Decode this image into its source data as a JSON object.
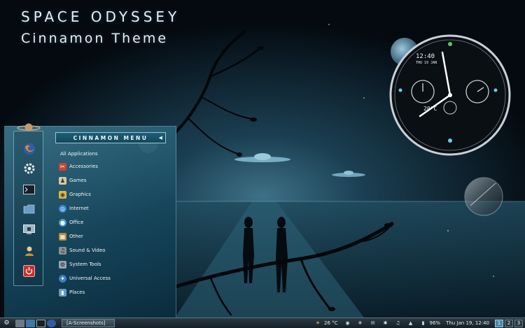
{
  "wallpaper": {
    "title": "SPACE ODYSSEY",
    "subtitle": "Cinnamon Theme"
  },
  "menu": {
    "header_label": "CINNAMON MENU",
    "header_arrow_icon": "arrow-left-icon",
    "all_applications": "All Applications",
    "favorites": [
      {
        "name": "firefox-icon"
      },
      {
        "name": "settings-icon"
      },
      {
        "name": "terminal-icon"
      },
      {
        "name": "files-icon"
      },
      {
        "name": "lock-screen-icon"
      },
      {
        "name": "logout-icon"
      },
      {
        "name": "shutdown-icon"
      }
    ],
    "categories": [
      {
        "label": "Accessories",
        "icon": "accessories-icon",
        "color": "#c8452e"
      },
      {
        "label": "Games",
        "icon": "games-icon",
        "color": "#d7c8a0"
      },
      {
        "label": "Graphics",
        "icon": "graphics-icon",
        "color": "#d8b84a"
      },
      {
        "label": "Internet",
        "icon": "internet-icon",
        "color": "#3f86c8"
      },
      {
        "label": "Office",
        "icon": "office-icon",
        "color": "#4a9fd6"
      },
      {
        "label": "Other",
        "icon": "other-icon",
        "color": "#b48c3c"
      },
      {
        "label": "Sound & Video",
        "icon": "sound-video-icon",
        "color": "#8a8f96"
      },
      {
        "label": "System Tools",
        "icon": "system-tools-icon",
        "color": "#9aa2a8"
      },
      {
        "label": "Universal Access",
        "icon": "universal-access-icon",
        "color": "#3c7fc2"
      },
      {
        "label": "Places",
        "icon": "places-icon",
        "color": "#6a98c8"
      }
    ]
  },
  "clock": {
    "time": "12:40",
    "day": "THU 19 JAN",
    "temp": "20°C"
  },
  "taskbar": {
    "window_label": "[A-Screenshots]",
    "weather": "26 °C",
    "battery": "96%",
    "datetime": "Thu Jan 19, 12:40",
    "workspaces": [
      "1",
      "2",
      "3"
    ],
    "active_workspace": "1"
  },
  "colors": {
    "panel_accent": "#1e5f78",
    "highlight": "#4a8aa8"
  }
}
